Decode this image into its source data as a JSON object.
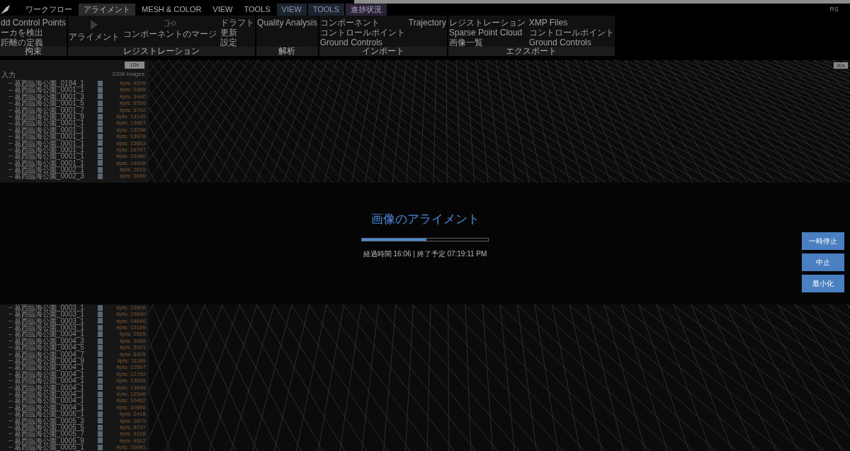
{
  "top_tabs": [
    {
      "label": "ワークフロー",
      "selected": false,
      "kind": "normal"
    },
    {
      "label": "アライメント",
      "selected": true,
      "kind": "normal"
    },
    {
      "label": "MESH & COLOR",
      "selected": false,
      "kind": "normal"
    },
    {
      "label": "VIEW",
      "selected": false,
      "kind": "normal"
    },
    {
      "label": "TOOLS",
      "selected": false,
      "kind": "normal"
    },
    {
      "label": "VIEW",
      "selected": false,
      "kind": "context"
    },
    {
      "label": "TOOLS",
      "selected": false,
      "kind": "context"
    },
    {
      "label": "進捗状況",
      "selected": false,
      "kind": "progress"
    }
  ],
  "user": "RS",
  "ribbon_groups": [
    {
      "label": "拘束",
      "columns": [
        [
          {
            "label": "dd Control Points",
            "kind": "small"
          },
          {
            "label": "ーカを検出",
            "kind": "small"
          },
          {
            "label": "距離の定義",
            "kind": "small"
          }
        ]
      ]
    },
    {
      "label": "レジストレーション",
      "columns": [
        [
          {
            "label": "アライメント",
            "kind": "big"
          }
        ],
        [
          {
            "label": "コンポーネントのマージ",
            "kind": "big"
          }
        ],
        [
          {
            "label": "ドラフト",
            "kind": "small"
          },
          {
            "label": "更新",
            "kind": "small"
          },
          {
            "label": "設定",
            "kind": "small"
          }
        ]
      ]
    },
    {
      "label": "解析",
      "columns": [
        [
          {
            "label": "Quality Analysis",
            "kind": "small"
          }
        ]
      ]
    },
    {
      "label": "インポート",
      "columns": [
        [
          {
            "label": "コンポーネント",
            "kind": "small"
          },
          {
            "label": "コントロールポイント",
            "kind": "small"
          },
          {
            "label": "Ground Controls",
            "kind": "small"
          }
        ],
        [
          {
            "label": "Trajectory",
            "kind": "small"
          }
        ]
      ]
    },
    {
      "label": "エクスポート",
      "columns": [
        [
          {
            "label": "レジストレーション",
            "kind": "small"
          },
          {
            "label": "Sparse Point Cloud",
            "kind": "small"
          },
          {
            "label": "画像一覧",
            "kind": "small"
          }
        ],
        [
          {
            "label": "XMP Files",
            "kind": "small"
          },
          {
            "label": "コントロールポイント",
            "kind": "small"
          },
          {
            "label": "Ground Controls",
            "kind": "small"
          }
        ]
      ]
    }
  ],
  "panel_1d": {
    "badge": "1Ds",
    "root": "入力",
    "count": "2208 images",
    "rows_top": [
      {
        "name": "葛西臨海公園_0184_1",
        "pts": "#pts: 9205"
      },
      {
        "name": "葛西臨海公園_0001_1",
        "pts": "#pts: 2865"
      },
      {
        "name": "葛西臨海公園_0001_3",
        "pts": "#pts: 3440"
      },
      {
        "name": "葛西臨海公園_0001_5",
        "pts": "#pts: 6556"
      },
      {
        "name": "葛西臨海公園_0001_7",
        "pts": "#pts: 6792"
      },
      {
        "name": "葛西臨海公園_0001_9",
        "pts": "#pts: 13145"
      },
      {
        "name": "葛西臨海公園_0001_1",
        "pts": "#pts: 13807"
      },
      {
        "name": "葛西臨海公園_0001_1",
        "pts": "#pts: 13298"
      },
      {
        "name": "葛西臨海公園_0001_1",
        "pts": "#pts: 13978"
      },
      {
        "name": "葛西臨海公園_0001_1",
        "pts": "#pts: 15853"
      },
      {
        "name": "葛西臨海公園_0001_1",
        "pts": "#pts: 16797"
      },
      {
        "name": "葛西臨海公園_0001_1",
        "pts": "#pts: 15980"
      },
      {
        "name": "葛西臨海公園_0001_1",
        "pts": "#pts: 14008"
      },
      {
        "name": "葛西臨海公園_0002_1",
        "pts": "#pts: 2619"
      },
      {
        "name": "葛西臨海公園_0002_3",
        "pts": "#pts: 3099"
      }
    ],
    "rows_bottom": [
      {
        "name": "葛西臨海公園_0003_1",
        "pts": "#pts: 16606"
      },
      {
        "name": "葛西臨海公園_0003_1",
        "pts": "#pts: 15840"
      },
      {
        "name": "葛西臨海公園_0003_1",
        "pts": "#pts: 14646"
      },
      {
        "name": "葛西臨海公園_0003_1",
        "pts": "#pts: 13189"
      },
      {
        "name": "葛西臨海公園_0004_1",
        "pts": "#pts: 2655"
      },
      {
        "name": "葛西臨海公園_0004_3",
        "pts": "#pts: 3065"
      },
      {
        "name": "葛西臨海公園_0004_5",
        "pts": "#pts: 5921"
      },
      {
        "name": "葛西臨海公園_0004_7",
        "pts": "#pts: 6205"
      },
      {
        "name": "葛西臨海公園_0004_9",
        "pts": "#pts: 11189"
      },
      {
        "name": "葛西臨海公園_0004_1",
        "pts": "#pts: 12507"
      },
      {
        "name": "葛西臨海公園_0004_1",
        "pts": "#pts: 12759"
      },
      {
        "name": "葛西臨海公園_0004_1",
        "pts": "#pts: 13838"
      },
      {
        "name": "葛西臨海公園_0004_1",
        "pts": "#pts: 13849"
      },
      {
        "name": "葛西臨海公園_0004_1",
        "pts": "#pts: 12546"
      },
      {
        "name": "葛西臨海公園_0004_1",
        "pts": "#pts: 10492"
      },
      {
        "name": "葛西臨海公園_0004_1",
        "pts": "#pts: 10898"
      },
      {
        "name": "葛西臨海公園_0005_1",
        "pts": "#pts: 2418"
      },
      {
        "name": "葛西臨海公園_0005_3",
        "pts": "#pts: 2879"
      },
      {
        "name": "葛西臨海公園_0005_5",
        "pts": "#pts: 5737"
      },
      {
        "name": "葛西臨海公園_0005_7",
        "pts": "#pts: 6128"
      },
      {
        "name": "葛西臨海公園_0005_9",
        "pts": "#pts: 9312"
      },
      {
        "name": "葛西臨海公園_0005_1",
        "pts": "#pts: 10081"
      }
    ]
  },
  "view_3d": {
    "badge": "3Ds"
  },
  "progress_dialog": {
    "title": "画像のアライメント",
    "level": 0.51,
    "status": "経過時間 16:06 | 終了予定 07:19:11 PM",
    "buttons": [
      "一時停止",
      "中止",
      "最小化"
    ]
  }
}
